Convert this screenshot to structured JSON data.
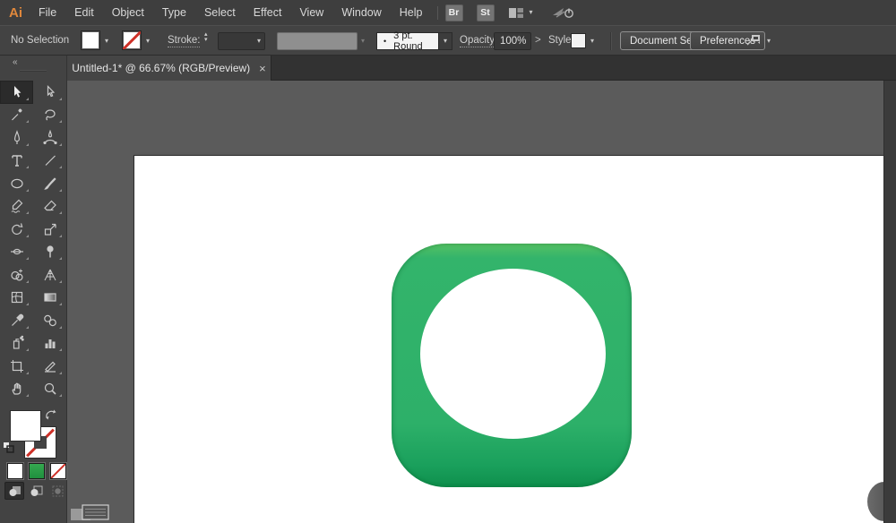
{
  "app": {
    "logo": "Ai"
  },
  "menubar": {
    "items": [
      "File",
      "Edit",
      "Object",
      "Type",
      "Select",
      "Effect",
      "View",
      "Window",
      "Help"
    ],
    "bridge_button": "Br",
    "stock_button": "St"
  },
  "controlbar": {
    "selection_status": "No Selection",
    "stroke_label": "Stroke:",
    "brush_bullet": "•",
    "brush_preset": "3 pt. Round",
    "opacity_label": "Opacity:",
    "opacity_value": "100%",
    "opacity_arrow": ">",
    "style_label": "Style:",
    "document_setup_button": "Document Setup",
    "preferences_button": "Preferences"
  },
  "tabbar": {
    "collapse_glyph": "«",
    "active_tab_title": "Untitled-1* @ 66.67% (RGB/Preview)",
    "close_glyph": "×"
  },
  "toolbar": {
    "tools": [
      "selection",
      "direct-selection",
      "magic-wand",
      "lasso",
      "pen",
      "curvature",
      "type",
      "line-segment",
      "ellipse",
      "paintbrush",
      "shaper",
      "eraser",
      "rotate",
      "scale",
      "width",
      "puppet-warp",
      "shape-builder",
      "perspective-grid",
      "mesh",
      "gradient",
      "eyedropper",
      "blend",
      "symbol-sprayer",
      "column-graph",
      "artboard",
      "slice",
      "hand",
      "zoom"
    ],
    "selected_tool": "selection",
    "swatches": {
      "fill": "#FFFFFF",
      "stroke": "none",
      "color": "#FFFFFF",
      "gradient": "#2E9B47",
      "none": "none"
    }
  },
  "icons": {
    "dropdown_chevron": "▾",
    "spinner_up": "▴",
    "spinner_down": "▾"
  },
  "canvas": {
    "zoom_level": "66.67%",
    "artboard_color": "#FFFFFF",
    "artwork": {
      "rounded_square_fill_top": "#55C163",
      "rounded_square_fill_main": "#2DB069",
      "rounded_square_fill_bottom": "#0E8F4C",
      "ellipse_fill": "#FFFFFF"
    }
  },
  "colors": {
    "menubar_bg": "#3E3E3E",
    "panel_bg": "#434343",
    "tabbar_bg": "#323232",
    "tab_active_bg": "#454545",
    "canvas_bg": "#5B5B5B",
    "logo_orange": "#E0883C",
    "none_slash_red": "#CE3128",
    "toolbar_swatch_green": "#2E9B47"
  }
}
